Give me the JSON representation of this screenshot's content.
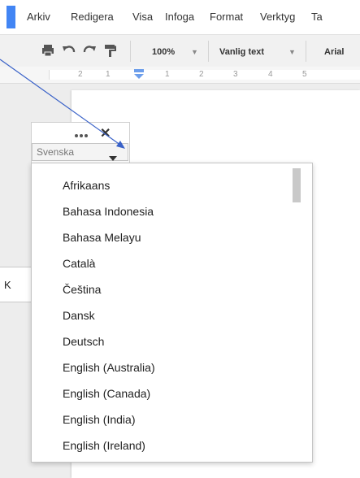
{
  "menubar": {
    "items": [
      "Arkiv",
      "Redigera",
      "Visa",
      "Infoga",
      "Format",
      "Verktyg",
      "Ta"
    ]
  },
  "toolbar": {
    "zoom": "100%",
    "style": "Vanlig text",
    "font": "Arial"
  },
  "ruler": {
    "numbers": [
      "2",
      "1",
      "1",
      "2",
      "3",
      "4",
      "5"
    ]
  },
  "side_panel": {
    "letter": "K"
  },
  "language_widget": {
    "selected": "Svenska",
    "close": "✕"
  },
  "dropdown": {
    "options": [
      "Afrikaans",
      "Bahasa Indonesia",
      "Bahasa Melayu",
      "Català",
      "Čeština",
      "Dansk",
      "Deutsch",
      "English (Australia)",
      "English (Canada)",
      "English (India)",
      "English (Ireland)"
    ]
  },
  "colors": {
    "accent": "#4285f4",
    "annotation_arrow": "#3a62c8"
  }
}
